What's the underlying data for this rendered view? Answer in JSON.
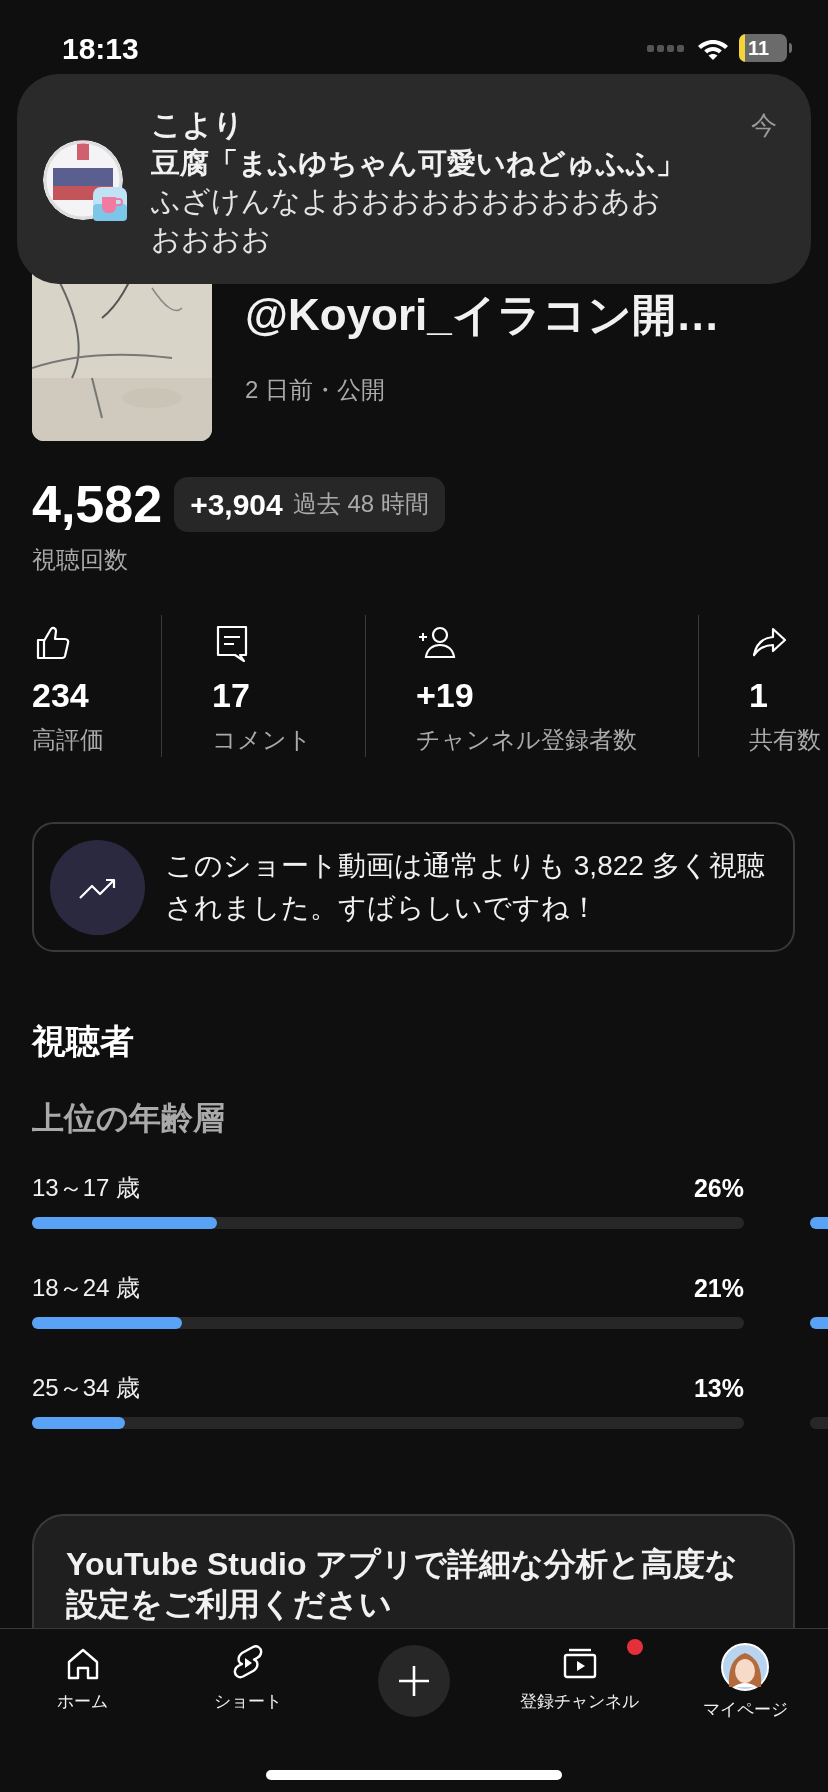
{
  "status_bar": {
    "time": "18:13",
    "battery": "11"
  },
  "notification": {
    "sender": "こより",
    "title": "豆腐「まふゆちゃん可愛いねどゅふふ」",
    "body": "ふざけんなよおおおおおおおおおあおおおおお",
    "time": "今"
  },
  "video": {
    "title": "@Koyori_イラコン開…",
    "meta": "2 日前・公開"
  },
  "views": {
    "count": "4,582",
    "delta": "+3,904",
    "period": "過去 48 時間",
    "label": "視聴回数"
  },
  "stats": [
    {
      "kind": "like",
      "value": "234",
      "label": "高評価"
    },
    {
      "kind": "comment",
      "value": "17",
      "label": "コメント"
    },
    {
      "kind": "subscriber",
      "value": "+19",
      "label": "チャンネル登録者数"
    },
    {
      "kind": "share",
      "value": "1",
      "label": "共有数"
    }
  ],
  "insight": {
    "text": "このショート動画は通常よりも 3,822 多く視聴されました。すばらしいですね！"
  },
  "audience": {
    "title": "視聴者",
    "age": {
      "title": "上位の年齢層",
      "rows": [
        {
          "label": "13～17 歳",
          "value": "26%",
          "level": 0.26
        },
        {
          "label": "18～24 歳",
          "value": "21%",
          "level": 0.21
        },
        {
          "label": "25～34 歳",
          "value": "13%",
          "level": 0.13
        }
      ]
    },
    "gender": {
      "rows": [
        {
          "filled": true
        },
        {
          "filled": true
        },
        {
          "filled": false
        }
      ]
    }
  },
  "promo": {
    "text": "YouTube Studio アプリで詳細な分析と高度な設定をご利用ください"
  },
  "nav": [
    {
      "kind": "home",
      "label": "ホーム",
      "badge": false
    },
    {
      "kind": "shorts",
      "label": "ショート",
      "badge": false
    },
    {
      "kind": "create"
    },
    {
      "kind": "subscriptions",
      "label": "登録チャンネル",
      "badge": true
    },
    {
      "kind": "you",
      "label": "マイページ",
      "badge": false
    }
  ]
}
